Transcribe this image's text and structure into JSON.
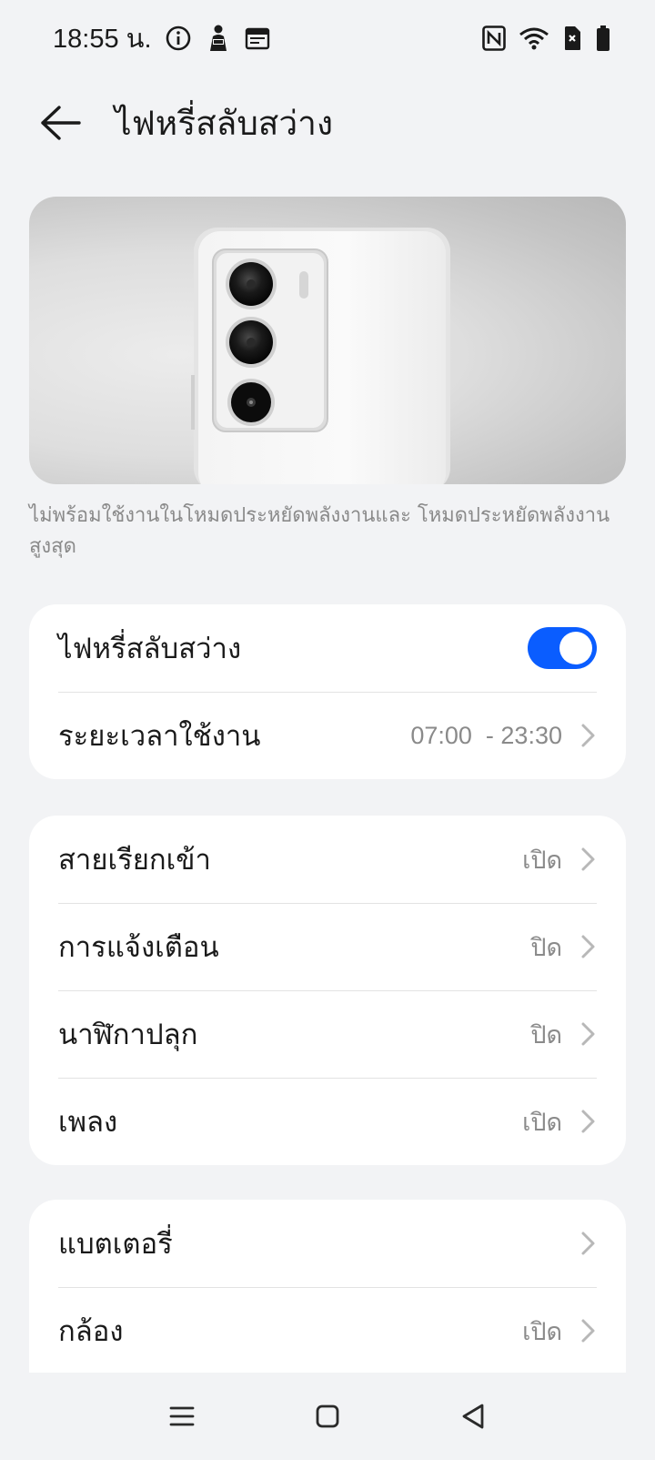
{
  "status_bar": {
    "time": "18:55 น.",
    "left_icons": [
      "info-icon",
      "reading-person-icon",
      "calendar-icon"
    ],
    "right_icons": [
      "nfc-icon",
      "wifi-icon",
      "no-sim-icon",
      "battery-icon"
    ]
  },
  "header": {
    "title": "ไฟหรี่สลับสว่าง"
  },
  "hero": {
    "image": "white-phone-rear-camera-image"
  },
  "hint_text": "ไม่พร้อมใช้งานในโหมดประหยัดพลังงานและ โหมดประหยัดพลังงานสูงสุด",
  "card_main": {
    "toggle_label": "ไฟหรี่สลับสว่าง",
    "toggle_on": true,
    "schedule_label": "ระยะเวลาใช้งาน",
    "schedule_value": "07:00  - 23:30"
  },
  "card_events": {
    "items": [
      {
        "label": "สายเรียกเข้า",
        "value": "เปิด"
      },
      {
        "label": "การแจ้งเตือน",
        "value": "ปิด"
      },
      {
        "label": "นาฬิกาปลุก",
        "value": "ปิด"
      },
      {
        "label": "เพลง",
        "value": "เปิด"
      }
    ]
  },
  "card_other": {
    "items": [
      {
        "label": "แบตเตอรี่",
        "value": ""
      },
      {
        "label": "กล้อง",
        "value": "เปิด"
      }
    ]
  },
  "colors": {
    "accent": "#0a5dff",
    "background": "#f2f3f5",
    "card": "#ffffff",
    "secondary_text": "#8a8a8a"
  },
  "nav_bar": {
    "icons": [
      "menu-icon",
      "home-icon",
      "back-icon"
    ]
  }
}
